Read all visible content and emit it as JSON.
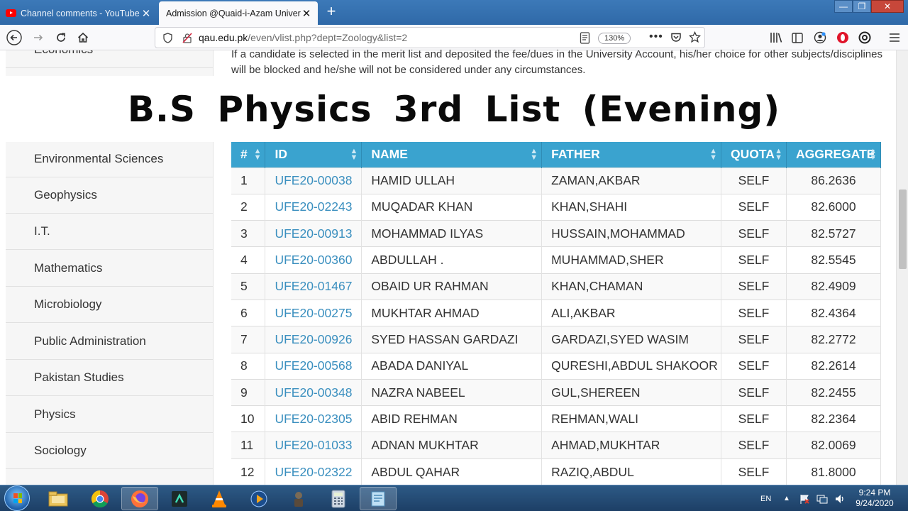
{
  "browser": {
    "tabs": [
      {
        "label": "Channel comments - YouTube S",
        "active": false,
        "icon": "youtube-icon"
      },
      {
        "label": "Admission @Quaid-i-Azam Univers",
        "active": true,
        "icon": ""
      }
    ],
    "url_host": "qau.edu.pk",
    "url_path": "/even/vlist.php?dept=Zoology&list=2",
    "zoom": "130%"
  },
  "sidebar": {
    "items": [
      {
        "label": "Economics"
      },
      {
        "label": "Environmental Sciences"
      },
      {
        "label": "Geophysics"
      },
      {
        "label": "I.T."
      },
      {
        "label": "Mathematics"
      },
      {
        "label": "Microbiology"
      },
      {
        "label": "Public Administration"
      },
      {
        "label": "Pakistan Studies"
      },
      {
        "label": "Physics"
      },
      {
        "label": "Sociology"
      }
    ]
  },
  "notice": "If a candidate is selected in the merit list and deposited the fee/dues in the University Account, his/her choice for other subjects/disciplines will be blocked and he/she will not be considered under any circumstances.",
  "banner": {
    "title": "B.S Physics 3rd List (Evening)"
  },
  "table": {
    "columns": [
      "#",
      "ID",
      "NAME",
      "FATHER",
      "QUOTA",
      "AGGREGATE"
    ],
    "rows": [
      {
        "n": "1",
        "id": "UFE20-00038",
        "name": "HAMID ULLAH",
        "father": "ZAMAN,AKBAR",
        "quota": "SELF",
        "agg": "86.2636"
      },
      {
        "n": "2",
        "id": "UFE20-02243",
        "name": "MUQADAR KHAN",
        "father": "KHAN,SHAHI",
        "quota": "SELF",
        "agg": "82.6000"
      },
      {
        "n": "3",
        "id": "UFE20-00913",
        "name": "MOHAMMAD ILYAS",
        "father": "HUSSAIN,MOHAMMAD",
        "quota": "SELF",
        "agg": "82.5727"
      },
      {
        "n": "4",
        "id": "UFE20-00360",
        "name": "ABDULLAH .",
        "father": "MUHAMMAD,SHER",
        "quota": "SELF",
        "agg": "82.5545"
      },
      {
        "n": "5",
        "id": "UFE20-01467",
        "name": "OBAID UR RAHMAN",
        "father": "KHAN,CHAMAN",
        "quota": "SELF",
        "agg": "82.4909"
      },
      {
        "n": "6",
        "id": "UFE20-00275",
        "name": "MUKHTAR AHMAD",
        "father": "ALI,AKBAR",
        "quota": "SELF",
        "agg": "82.4364"
      },
      {
        "n": "7",
        "id": "UFE20-00926",
        "name": "SYED HASSAN GARDAZI",
        "father": "GARDAZI,SYED WASIM",
        "quota": "SELF",
        "agg": "82.2772"
      },
      {
        "n": "8",
        "id": "UFE20-00568",
        "name": "ABADA DANIYAL",
        "father": "QURESHI,ABDUL SHAKOOR",
        "quota": "SELF",
        "agg": "82.2614"
      },
      {
        "n": "9",
        "id": "UFE20-00348",
        "name": "NAZRA NABEEL",
        "father": "GUL,SHEREEN",
        "quota": "SELF",
        "agg": "82.2455"
      },
      {
        "n": "10",
        "id": "UFE20-02305",
        "name": "ABID REHMAN",
        "father": "REHMAN,WALI",
        "quota": "SELF",
        "agg": "82.2364"
      },
      {
        "n": "11",
        "id": "UFE20-01033",
        "name": "ADNAN MUKHTAR",
        "father": "AHMAD,MUKHTAR",
        "quota": "SELF",
        "agg": "82.0069"
      },
      {
        "n": "12",
        "id": "UFE20-02322",
        "name": "ABDUL QAHAR",
        "father": "RAZIQ,ABDUL",
        "quota": "SELF",
        "agg": "81.8000"
      }
    ]
  },
  "taskbar": {
    "language": "EN",
    "time": "9:24 PM",
    "date": "9/24/2020"
  },
  "colors": {
    "header_blue": "#3aa3cf",
    "link_blue": "#3a8fbf",
    "titlebar_blue": "#2f69a8",
    "taskbar_blue": "#1d3f66"
  }
}
